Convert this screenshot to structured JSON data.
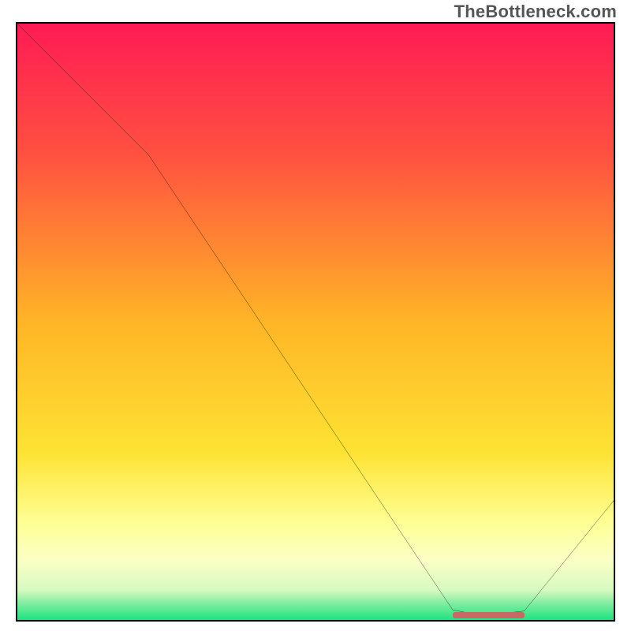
{
  "watermark": "TheBottleneck.com",
  "chart_data": {
    "type": "line",
    "title": "",
    "xlabel": "",
    "ylabel": "",
    "xlim": [
      0,
      100
    ],
    "ylim": [
      0,
      100
    ],
    "x": [
      0,
      22,
      73,
      78,
      85,
      100
    ],
    "values": [
      100,
      78,
      1.7,
      0.7,
      1.5,
      20
    ],
    "marker": {
      "x_start": 73,
      "x_end": 85,
      "y": 0.8,
      "color": "#c66a63"
    },
    "gradient_stops": [
      {
        "pos": 0,
        "color": "#ff1b54"
      },
      {
        "pos": 22,
        "color": "#ff5140"
      },
      {
        "pos": 50,
        "color": "#ffb526"
      },
      {
        "pos": 72,
        "color": "#fde333"
      },
      {
        "pos": 84,
        "color": "#feff97"
      },
      {
        "pos": 90,
        "color": "#fbffc5"
      },
      {
        "pos": 95,
        "color": "#d6fac0"
      },
      {
        "pos": 97,
        "color": "#89eea4"
      },
      {
        "pos": 100,
        "color": "#1de480"
      }
    ]
  }
}
